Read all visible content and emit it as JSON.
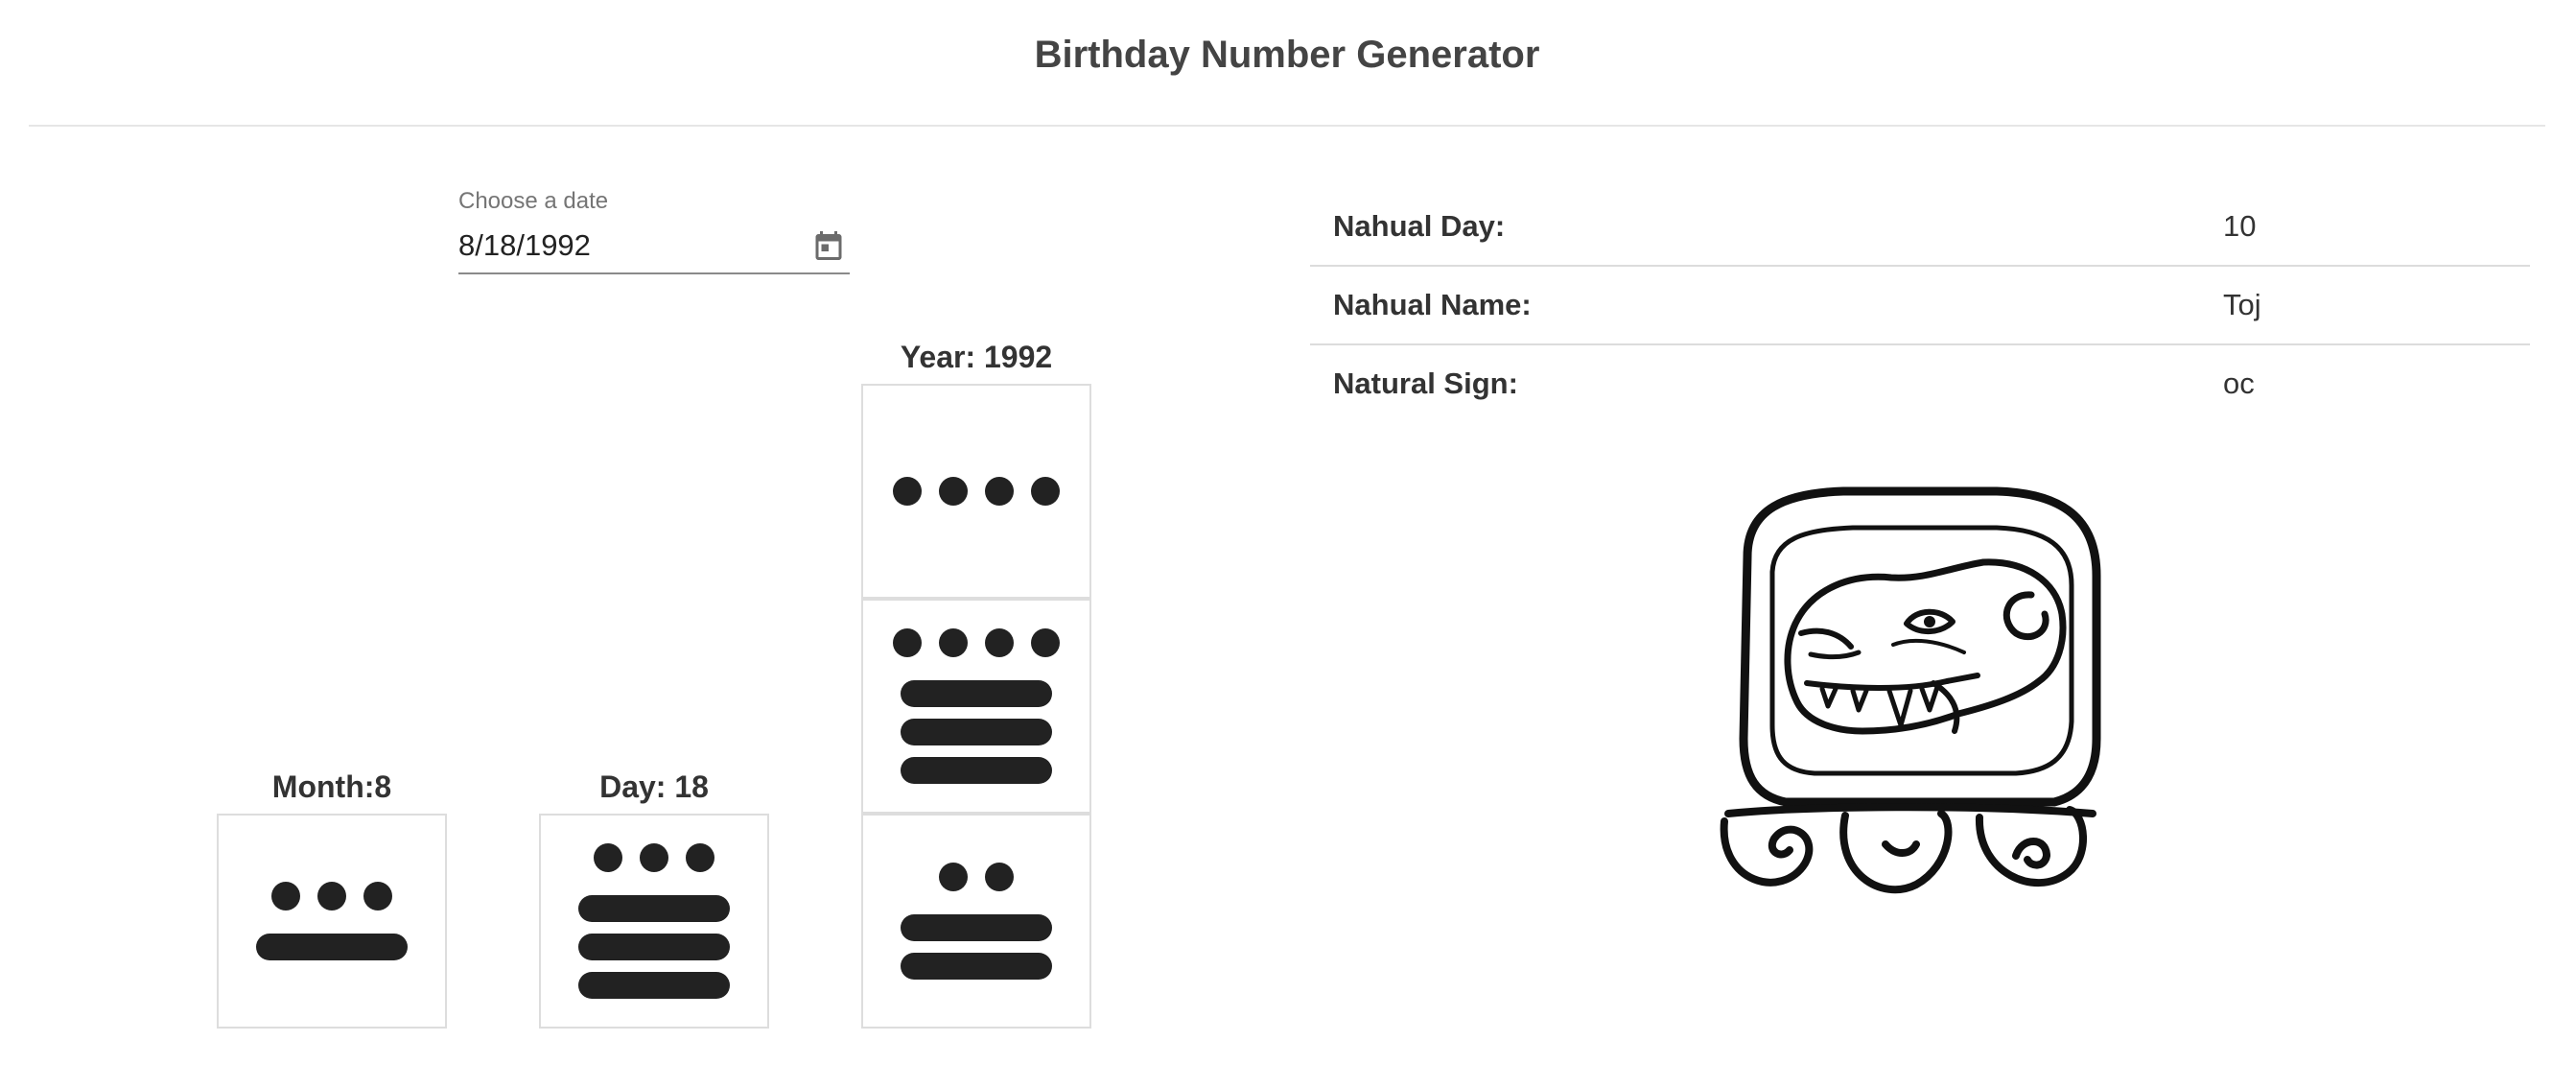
{
  "header": {
    "title": "Birthday Number Generator"
  },
  "date_picker": {
    "label": "Choose a date",
    "value": "8/18/1992",
    "calendar_icon": "calendar-icon"
  },
  "glyphs": {
    "month": {
      "label": "Month:8",
      "levels": [
        {
          "dots": 3,
          "bars": 1
        }
      ]
    },
    "day": {
      "label": "Day: 18",
      "levels": [
        {
          "dots": 3,
          "bars": 3
        }
      ]
    },
    "year": {
      "label": "Year: 1992",
      "levels": [
        {
          "dots": 4,
          "bars": 0
        },
        {
          "dots": 4,
          "bars": 3
        },
        {
          "dots": 2,
          "bars": 2
        }
      ]
    }
  },
  "info": {
    "rows": [
      {
        "key": "Nahual Day:",
        "value": "10"
      },
      {
        "key": "Nahual Name:",
        "value": "Toj"
      },
      {
        "key": "Natural Sign:",
        "value": "oc"
      }
    ]
  },
  "colors": {
    "glyph": "#222222",
    "divider": "#dcdcdc"
  }
}
